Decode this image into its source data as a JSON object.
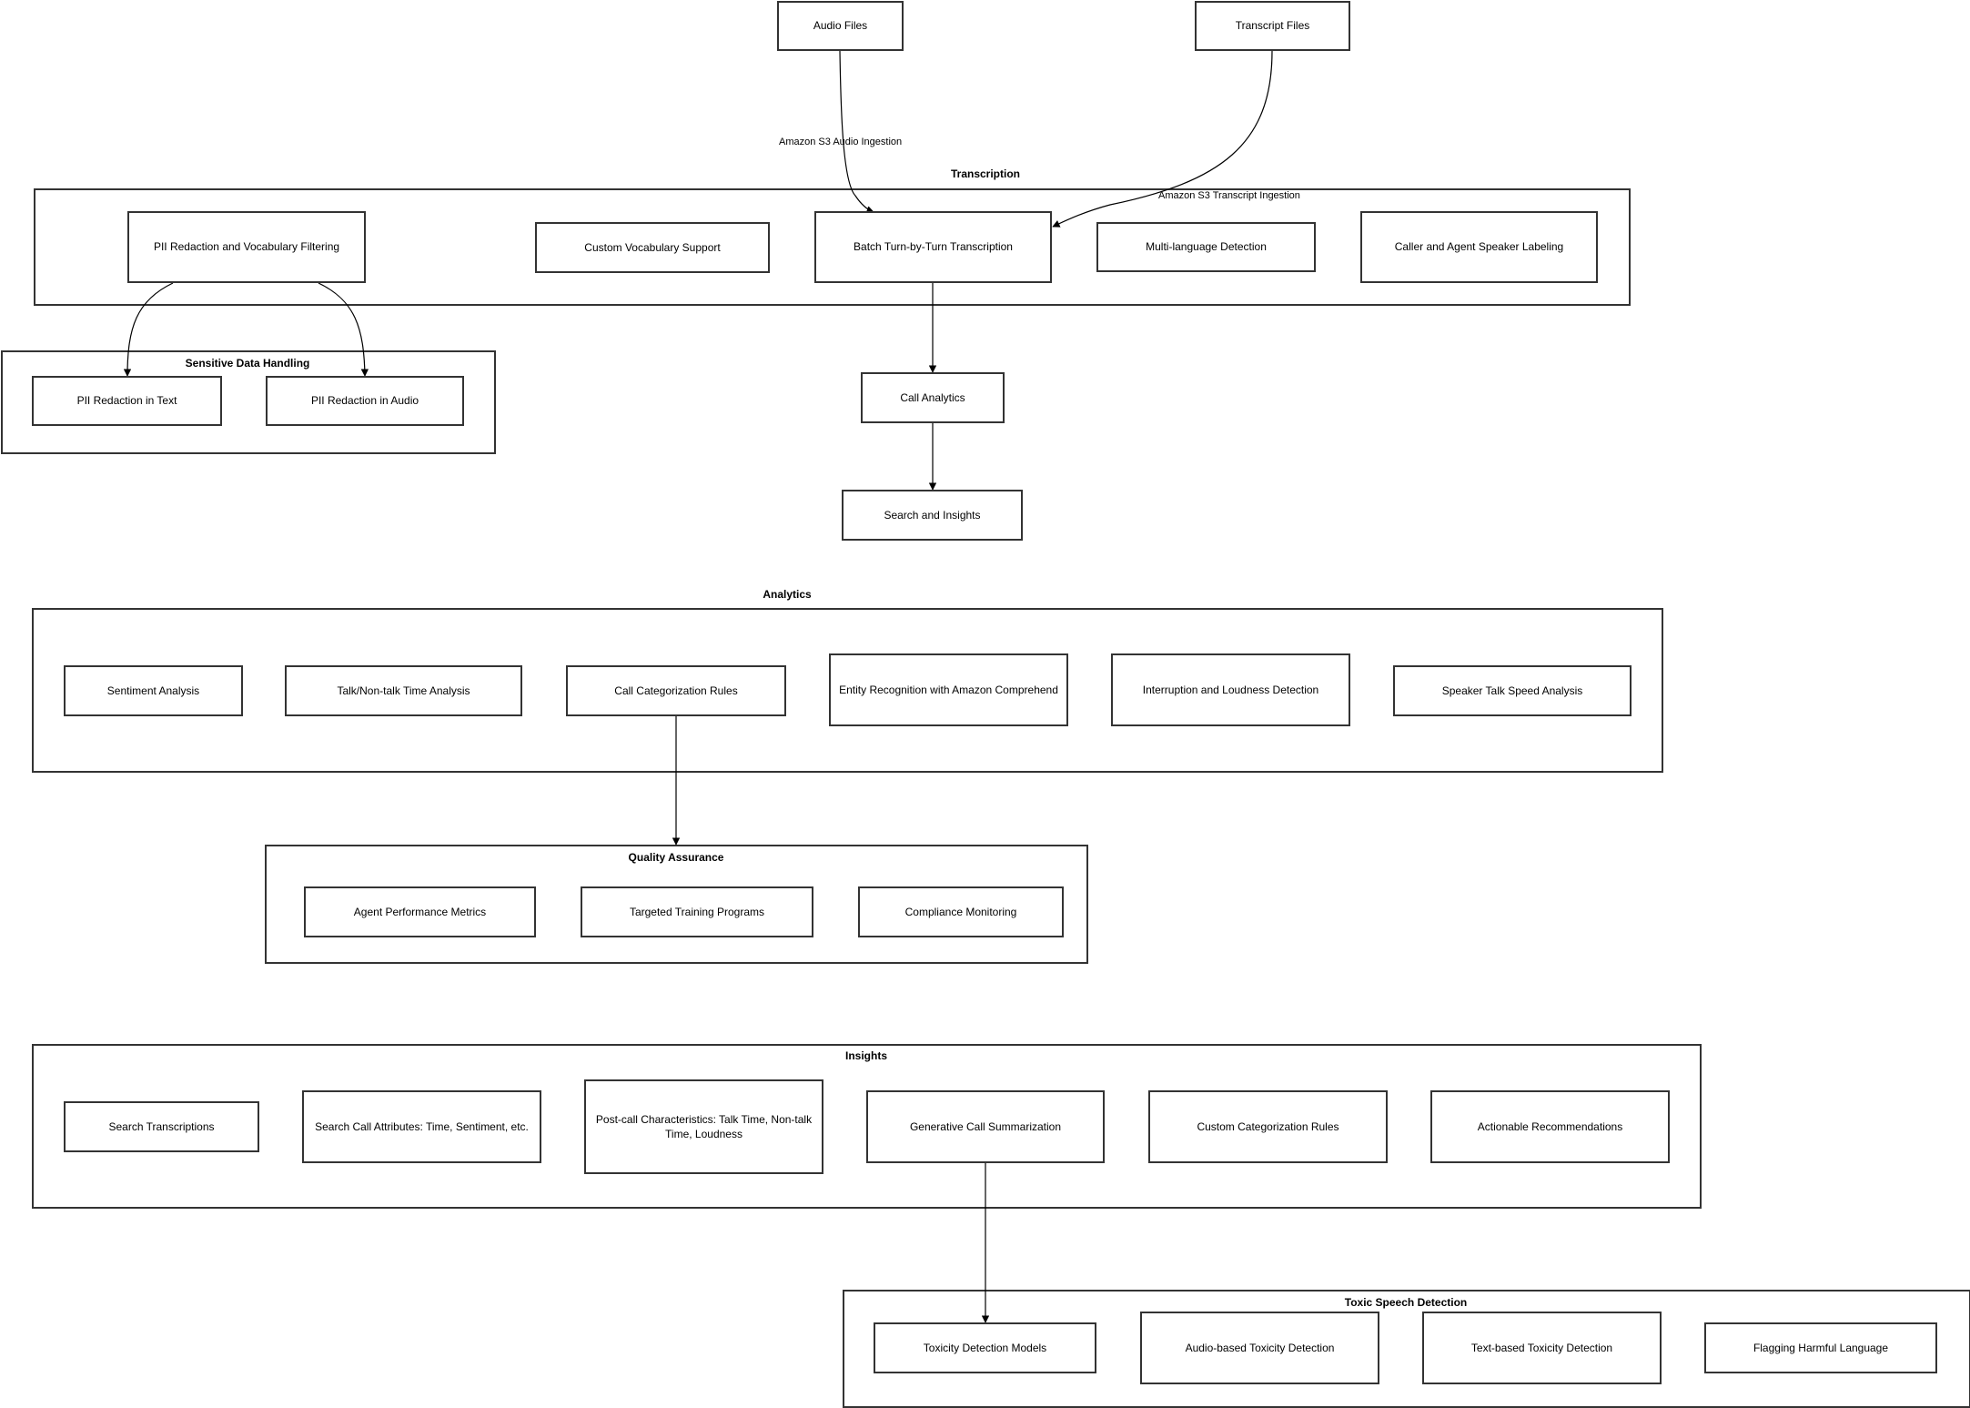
{
  "diagram": {
    "sources": {
      "audio_files": "Audio Files",
      "transcript_files": "Transcript Files"
    },
    "edge_labels": {
      "audio_ingestion": "Amazon S3 Audio Ingestion",
      "transcript_ingestion": "Amazon S3 Transcript Ingestion"
    },
    "groups": {
      "transcription": {
        "title": "Transcription",
        "nodes": [
          "PII Redaction and Vocabulary Filtering",
          "Custom Vocabulary Support",
          "Batch Turn-by-Turn Transcription",
          "Multi-language Detection",
          "Caller and Agent Speaker Labeling"
        ]
      },
      "sensitive_data": {
        "title": "Sensitive Data Handling",
        "nodes": [
          "PII Redaction in Text",
          "PII Redaction in Audio"
        ]
      },
      "analytics": {
        "title": "Analytics",
        "nodes": [
          "Sentiment Analysis",
          "Talk/Non-talk Time Analysis",
          "Call Categorization Rules",
          "Entity Recognition with Amazon Comprehend",
          "Interruption and Loudness Detection",
          "Speaker Talk Speed Analysis"
        ]
      },
      "quality_assurance": {
        "title": "Quality Assurance",
        "nodes": [
          "Agent Performance Metrics",
          "Targeted Training Programs",
          "Compliance Monitoring"
        ]
      },
      "insights": {
        "title": "Insights",
        "nodes": [
          "Search Transcriptions",
          "Search Call Attributes: Time, Sentiment, etc.",
          "Post-call Characteristics: Talk Time, Non-talk Time, Loudness",
          "Generative Call Summarization",
          "Custom Categorization Rules",
          "Actionable Recommendations"
        ]
      },
      "toxic_speech": {
        "title": "Toxic Speech Detection",
        "nodes": [
          "Toxicity Detection Models",
          "Audio-based Toxicity Detection",
          "Text-based Toxicity Detection",
          "Flagging Harmful Language"
        ]
      }
    },
    "standalone": {
      "call_analytics": "Call Analytics",
      "search_and_insights": "Search and Insights"
    },
    "edges": [
      {
        "from": "Audio Files",
        "to": "Batch Turn-by-Turn Transcription",
        "label": "Amazon S3 Audio Ingestion"
      },
      {
        "from": "Transcript Files",
        "to": "Batch Turn-by-Turn Transcription",
        "label": "Amazon S3 Transcript Ingestion"
      },
      {
        "from": "PII Redaction and Vocabulary Filtering",
        "to": "PII Redaction in Text"
      },
      {
        "from": "PII Redaction and Vocabulary Filtering",
        "to": "PII Redaction in Audio"
      },
      {
        "from": "Batch Turn-by-Turn Transcription",
        "to": "Call Analytics"
      },
      {
        "from": "Call Analytics",
        "to": "Search and Insights"
      },
      {
        "from": "Call Categorization Rules",
        "to": "Quality Assurance"
      },
      {
        "from": "Generative Call Summarization",
        "to": "Toxicity Detection Models"
      }
    ]
  }
}
